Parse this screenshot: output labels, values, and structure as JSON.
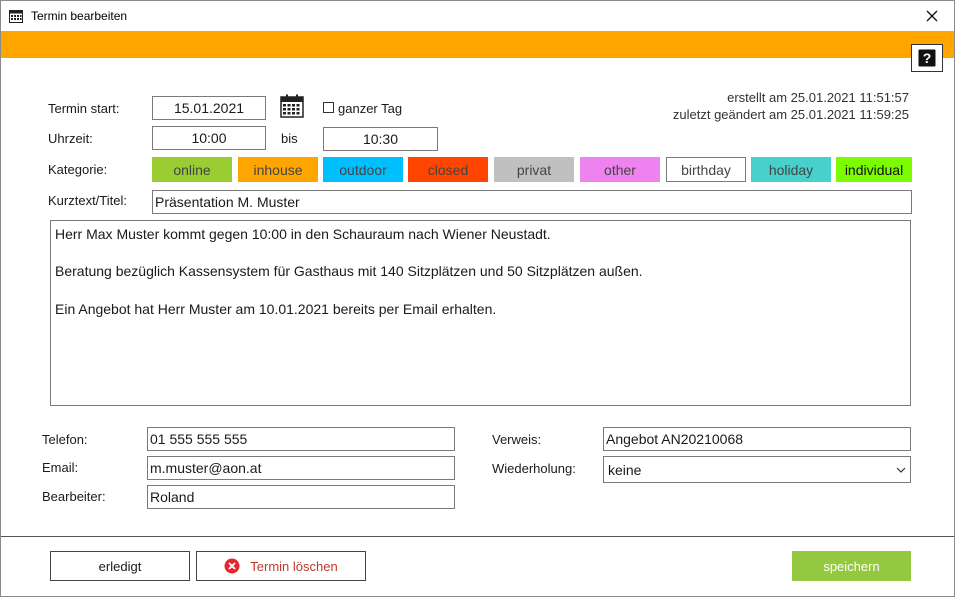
{
  "window": {
    "title": "Termin bearbeiten"
  },
  "form": {
    "start_label": "Termin start:",
    "start_date": "15.01.2021",
    "allday_label": "ganzer Tag",
    "time_label": "Uhrzeit:",
    "time_from": "10:00",
    "time_sep": "bis",
    "time_to": "10:30",
    "category_label": "Kategorie:",
    "title_label": "Kurztext/Titel:",
    "title_value": "Präsentation M. Muster"
  },
  "meta": {
    "created": "erstellt am 25.01.2021 11:51:57",
    "modified": "zuletzt geändert am 25.01.2021 11:59:25"
  },
  "categories": [
    {
      "label": "online",
      "color": "#9acd32",
      "text_color": "#444"
    },
    {
      "label": "inhouse",
      "color": "#ffa500",
      "text_color": "#444"
    },
    {
      "label": "outdoor",
      "color": "#00bfff",
      "text_color": "#444"
    },
    {
      "label": "closed",
      "color": "#ff4500",
      "text_color": "#444"
    },
    {
      "label": "privat",
      "color": "#c0c0c0",
      "text_color": "#444"
    },
    {
      "label": "other",
      "color": "#ee82ee",
      "text_color": "#444"
    },
    {
      "label": "birthday",
      "color": "#ffffff",
      "text_color": "#444"
    },
    {
      "label": "holiday",
      "color": "#48d1cc",
      "text_color": "#444"
    },
    {
      "label": "individual",
      "color": "#7cfc00",
      "text_color": "#111"
    }
  ],
  "description": {
    "line1": "Herr Max Muster kommt gegen 10:00 in den Schauraum nach Wiener Neustadt.",
    "line2": "Beratung bezüglich Kassensystem für Gasthaus mit 140 Sitzplätzen und 50 Sitzplätzen außen.",
    "line3": "Ein Angebot hat Herr Muster am 10.01.2021 bereits per Email erhalten."
  },
  "contact": {
    "phone_label": "Telefon:",
    "phone": "01 555 555 555",
    "email_label": "Email:",
    "email": "m.muster@aon.at",
    "editor_label": "Bearbeiter:",
    "editor": "Roland",
    "ref_label": "Verweis:",
    "ref": "Angebot AN20210068",
    "repeat_label": "Wiederholung:",
    "repeat": "keine"
  },
  "buttons": {
    "done": "erledigt",
    "delete": "Termin löschen",
    "save": "speichern"
  },
  "colors": {
    "accent": "#ffa500",
    "save": "#94c840",
    "delete_icon": "#e0282f"
  }
}
